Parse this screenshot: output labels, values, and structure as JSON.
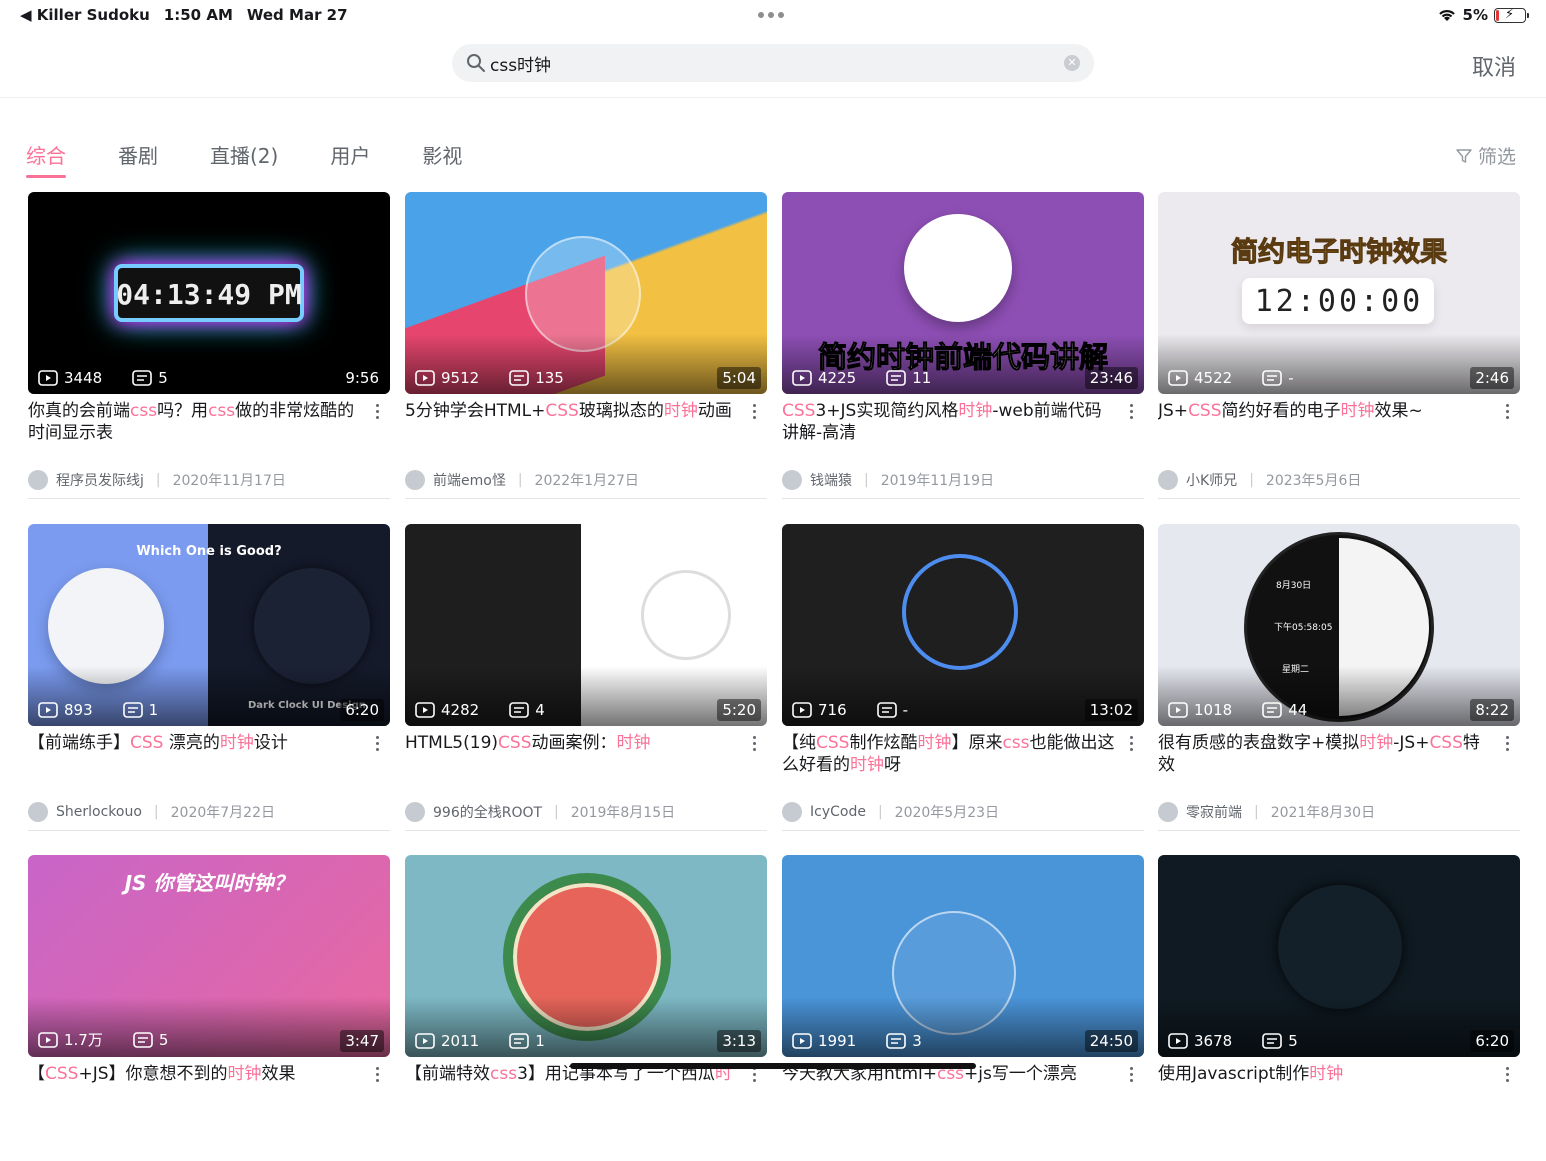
{
  "status": {
    "back_app": "Killer Sudoku",
    "time": "1:50 AM",
    "date": "Wed Mar 27",
    "battery": "5%",
    "battery_level": 0.05
  },
  "search": {
    "query": "css时钟",
    "placeholder": "搜索",
    "cancel_label": "取消"
  },
  "tabs": [
    {
      "label": "综合",
      "active": true
    },
    {
      "label": "番剧"
    },
    {
      "label": "直播(2)"
    },
    {
      "label": "用户"
    },
    {
      "label": "影视"
    }
  ],
  "filter_label": "筛选",
  "videos": [
    {
      "plays": "3448",
      "comments": "5",
      "duration": "9:56",
      "thumb_text": "04:13:49 PM",
      "title_parts": [
        [
          "你真的会前端",
          0
        ],
        [
          "css",
          1
        ],
        [
          "吗？用",
          0
        ],
        [
          "css",
          1
        ],
        [
          "做的非常炫酷的时间显示表",
          0
        ]
      ],
      "author": "程序员发际线j",
      "date": "2020年11月17日"
    },
    {
      "plays": "9512",
      "comments": "135",
      "duration": "5:04",
      "thumb_text": "",
      "title_parts": [
        [
          "5分钟学会HTML+",
          0
        ],
        [
          "CSS",
          1
        ],
        [
          "玻璃拟态的",
          0
        ],
        [
          "时钟",
          1
        ],
        [
          "动画",
          0
        ]
      ],
      "author": "前端emo怪",
      "date": "2022年1月27日"
    },
    {
      "plays": "4225",
      "comments": "11",
      "duration": "23:46",
      "thumb_text": "简约时钟前端代码讲解",
      "title_parts": [
        [
          "CSS",
          1
        ],
        [
          "3+JS实现简约风格",
          0
        ],
        [
          "时钟",
          1
        ],
        [
          "-web前端代码讲解-高清",
          0
        ]
      ],
      "author": "钱端猿",
      "date": "2019年11月19日"
    },
    {
      "plays": "4522",
      "comments": "-",
      "duration": "2:46",
      "thumb_text": "简约电子时钟效果",
      "thumb_text2": "12:00:00",
      "title_parts": [
        [
          "JS+",
          0
        ],
        [
          "CSS",
          1
        ],
        [
          "简约好看的电子",
          0
        ],
        [
          "时钟",
          1
        ],
        [
          "效果~",
          0
        ]
      ],
      "author": "小K师兄",
      "date": "2023年5月6日"
    },
    {
      "plays": "893",
      "comments": "1",
      "duration": "6:20",
      "thumb_text": "Which One is Good?",
      "thumb_text2": "Dark Clock UI Design",
      "title_parts": [
        [
          "【前端练手】",
          0
        ],
        [
          "CSS",
          1
        ],
        [
          "  漂亮的",
          0
        ],
        [
          "时钟",
          1
        ],
        [
          "设计",
          0
        ]
      ],
      "author": "Sherlockouo",
      "date": "2020年7月22日"
    },
    {
      "plays": "4282",
      "comments": "4",
      "duration": "5:20",
      "thumb_text": "",
      "title_parts": [
        [
          "HTML5(19)",
          0
        ],
        [
          "CSS",
          1
        ],
        [
          "动画案例：",
          0
        ],
        [
          "时钟",
          1
        ]
      ],
      "author": "996的全栈ROOT",
      "date": "2019年8月15日"
    },
    {
      "plays": "716",
      "comments": "-",
      "duration": "13:02",
      "thumb_text": "",
      "title_parts": [
        [
          "【纯",
          0
        ],
        [
          "CSS",
          1
        ],
        [
          "制作炫酷",
          0
        ],
        [
          "时钟",
          1
        ],
        [
          "】原来",
          0
        ],
        [
          "css",
          1
        ],
        [
          "也能做出这么好看的",
          0
        ],
        [
          "时钟",
          1
        ],
        [
          "呀",
          0
        ]
      ],
      "author": "IcyCode",
      "date": "2020年5月23日"
    },
    {
      "plays": "1018",
      "comments": "44",
      "duration": "8:22",
      "thumb_text": "下午05:58:05",
      "thumb_text2": "8月30日",
      "thumb_text3": "星期二",
      "title_parts": [
        [
          "很有质感的表盘数字+模拟",
          0
        ],
        [
          "时钟",
          1
        ],
        [
          "-JS+",
          0
        ],
        [
          "CSS",
          1
        ],
        [
          "特效",
          0
        ]
      ],
      "author": "零寂前端",
      "date": "2021年8月30日"
    },
    {
      "plays": "1.7万",
      "comments": "5",
      "duration": "3:47",
      "thumb_text": "JS 你管这叫时钟？",
      "title_parts": [
        [
          "【",
          0
        ],
        [
          "CSS",
          1
        ],
        [
          "+JS】你意想不到的",
          0
        ],
        [
          "时钟",
          1
        ],
        [
          "效果",
          0
        ]
      ],
      "author": "",
      "date": ""
    },
    {
      "plays": "2011",
      "comments": "1",
      "duration": "3:13",
      "thumb_text": "",
      "title_parts": [
        [
          "【前端特效",
          0
        ],
        [
          "css",
          1
        ],
        [
          "3】用记事本写了一个西瓜",
          0
        ],
        [
          "时",
          1
        ]
      ],
      "author": "",
      "date": ""
    },
    {
      "plays": "1991",
      "comments": "3",
      "duration": "24:50",
      "thumb_text": "",
      "title_parts": [
        [
          "今天教大家用html+",
          0
        ],
        [
          "css",
          1
        ],
        [
          "+js写一个漂亮",
          0
        ]
      ],
      "author": "",
      "date": ""
    },
    {
      "plays": "3678",
      "comments": "5",
      "duration": "6:20",
      "thumb_text": "",
      "title_parts": [
        [
          "使用Javascript制作",
          0
        ],
        [
          "时钟",
          1
        ]
      ],
      "author": "",
      "date": ""
    }
  ],
  "colors": {
    "accent": "#fb7299",
    "text": "#18191c",
    "muted": "#9499a0"
  }
}
